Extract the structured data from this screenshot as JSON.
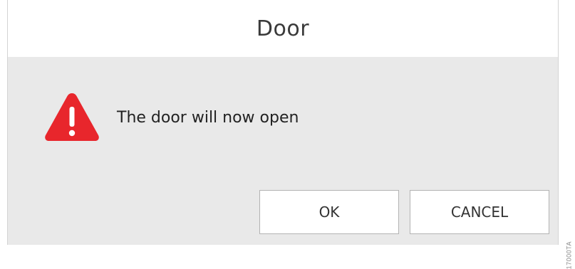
{
  "dialog": {
    "title": "Door",
    "message": "The door will now open",
    "icon": "warning-icon",
    "buttons": {
      "ok_label": "OK",
      "cancel_label": "CANCEL"
    }
  },
  "figure_code": "17000TA",
  "colors": {
    "warning_red": "#e8262c",
    "title_bar_bg": "#ffffff",
    "dialog_body_bg": "#e9e9e9",
    "button_bg": "#ffffff",
    "button_border": "#b3b3b3"
  }
}
